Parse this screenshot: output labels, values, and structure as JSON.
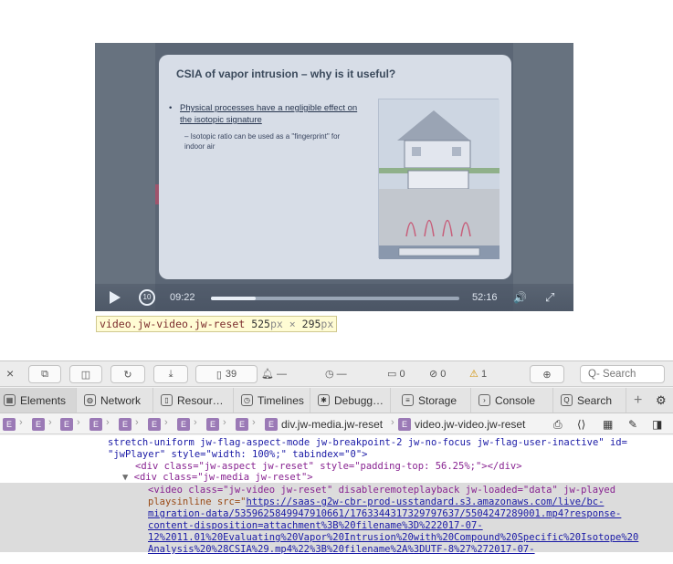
{
  "video": {
    "slide_title": "CSIA of vapor intrusion – why is it useful?",
    "bullet": "Physical processes have a negligible effect on the isotopic signature",
    "sub_bullet": "– Isotopic ratio can be used as a \"fingerprint\" for indoor air",
    "current_time": "09:22",
    "duration": "52:16",
    "progress": 0.18,
    "rewind_label": "10"
  },
  "tooltip": {
    "selector": "video.jw-video.jw-reset",
    "width": "525",
    "height": "295",
    "unit": "px",
    "times": "×"
  },
  "devtools": {
    "toolbar": {
      "resources_count": "39",
      "dash1": "—",
      "dash2": "—",
      "errors": "0",
      "warnings_mid": "0",
      "warnings": "1",
      "search_placeholder": "Search"
    },
    "tabs": [
      {
        "label": "Elements"
      },
      {
        "label": "Network"
      },
      {
        "label": "Resour…"
      },
      {
        "label": "Timelines"
      },
      {
        "label": "Debugg…"
      },
      {
        "label": "Storage"
      },
      {
        "label": "Console"
      },
      {
        "label": "Search"
      }
    ],
    "breadcrumb": {
      "e_label": "E",
      "item1": "div.jw-media.jw-reset",
      "item2": "video.jw-video.jw-reset"
    },
    "dom": {
      "line1": "stretch-uniform jw-flag-aspect-mode jw-breakpoint-2 jw-no-focus jw-flag-user-inactive\" id=",
      "line2": "\"jwPlayer\" style=\"width: 100%;\" tabindex=\"0\">",
      "line3": "<div class=\"jw-aspect jw-reset\" style=\"padding-top: 56.25%;\"></div>",
      "line4": "<div class=\"jw-media jw-reset\">",
      "line5a": "<video class=\"jw-video jw-reset\" disableremoteplayback jw-loaded=\"data\" jw-played",
      "line6a": "playsinline src=\"",
      "line6b": "https://saas-g2w-cbr-prod-usstandard.s3.amazonaws.com/live/bc-",
      "line7": "migration-data/5359625849947910661/1763344317329797637/5504247289001.mp4?response-",
      "line8": "content-disposition=attachment%3B%20filename%3D%222017-07-",
      "line9": "12%2011.01%20Evaluating%20Vapor%20Intrusion%20with%20Compound%20Specific%20Isotope%20",
      "line10": "Analysis%20%28CSIA%29.mp4%22%3B%20filename%2A%3DUTF-8%27%272017-07-"
    }
  },
  "colors": {
    "tag": "#882391",
    "attribute": "#9a4b17",
    "value": "#1a1aa6",
    "warning": "#d08f00"
  }
}
